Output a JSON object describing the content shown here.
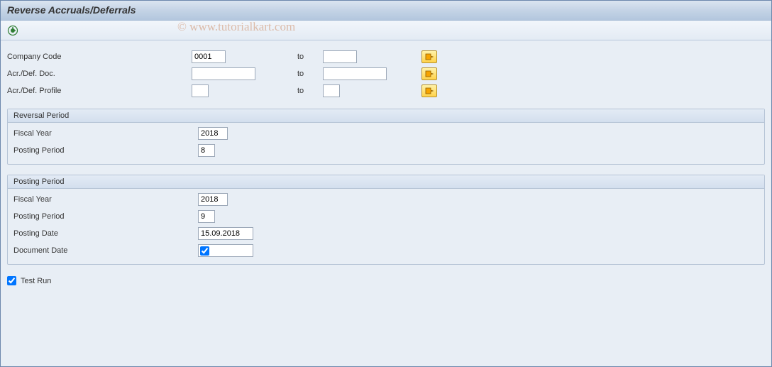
{
  "title": "Reverse Accruals/Deferrals",
  "watermark": "© www.tutorialkart.com",
  "selection": {
    "company_code": {
      "label": "Company Code",
      "from": "0001",
      "to_label": "to",
      "to": ""
    },
    "acr_def_doc": {
      "label": "Acr./Def. Doc.",
      "from": "",
      "to_label": "to",
      "to": ""
    },
    "acr_def_profile": {
      "label": "Acr./Def. Profile",
      "from": "",
      "to_label": "to",
      "to": ""
    }
  },
  "reversal_period": {
    "title": "Reversal Period",
    "fiscal_year": {
      "label": "Fiscal Year",
      "value": "2018"
    },
    "posting_period": {
      "label": "Posting Period",
      "value": "8"
    }
  },
  "posting_period": {
    "title": "Posting Period",
    "fiscal_year": {
      "label": "Fiscal Year",
      "value": "2018"
    },
    "posting_period": {
      "label": "Posting Period",
      "value": "9"
    },
    "posting_date": {
      "label": "Posting Date",
      "value": "15.09.2018"
    },
    "document_date": {
      "label": "Document Date",
      "checked": true
    }
  },
  "test_run": {
    "label": "Test Run",
    "checked": true
  }
}
